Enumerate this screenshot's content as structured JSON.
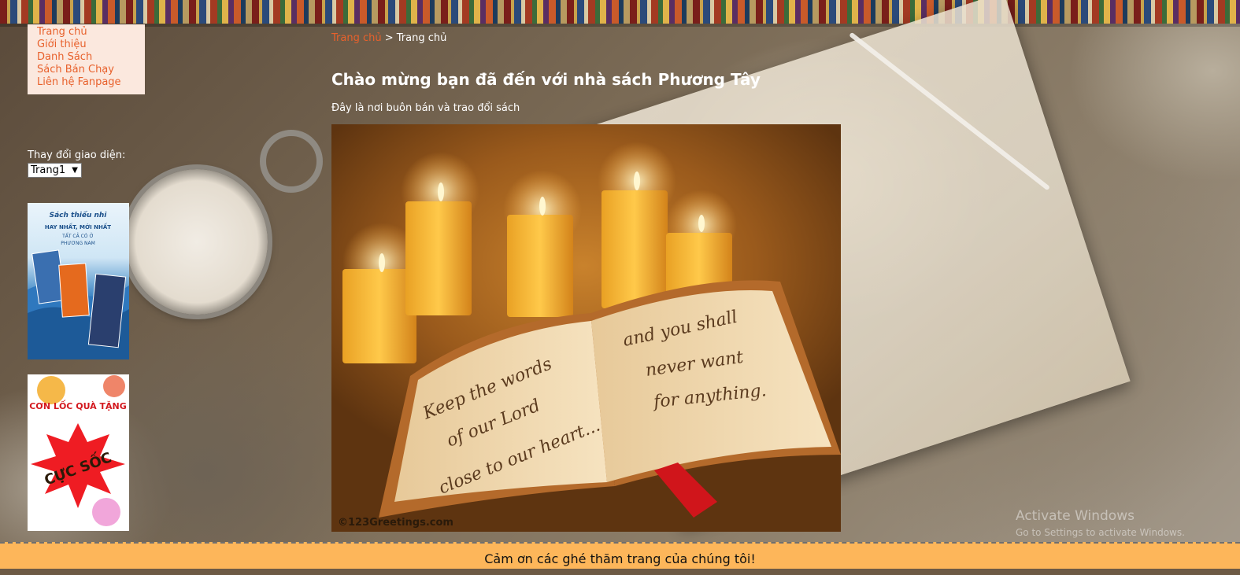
{
  "menu": {
    "items": [
      {
        "label": "Trang chủ"
      },
      {
        "label": "Giới thiệu"
      },
      {
        "label": "Danh Sách"
      },
      {
        "label": "Sách Bán Chạy"
      },
      {
        "label": "Liên hệ Fanpage"
      }
    ]
  },
  "theme": {
    "label": "Thay đổi giao diện:",
    "selected": "Trang1"
  },
  "ads": {
    "ad1": {
      "line1": "Sách thiếu nhi",
      "line2": "HAY NHẤT, MỚI NHẤT",
      "line3": "TẤT CẢ CÓ Ở",
      "line4": "PHƯƠNG NAM"
    },
    "ad2": {
      "line1": "CƠN LỐC QUÀ TẶNG",
      "line2": "CỰC SỐC"
    }
  },
  "breadcrumb": {
    "home": "Trang chủ",
    "separator": ">",
    "current": "Trang chủ"
  },
  "main": {
    "title": "Chào mừng bạn đã đến với nhà sách Phương Tây",
    "subtitle": "Đây là nơi buôn bán và trao đổi sách"
  },
  "hero": {
    "left_page": [
      "Keep the words",
      "of our Lord",
      "close to our heart..."
    ],
    "right_page": [
      "and you shall",
      "never want",
      "for anything."
    ],
    "credit": "©123Greetings.com"
  },
  "footer": {
    "text": "Cảm ơn các ghé thăm trang của chúng tôi!"
  },
  "system": {
    "activate_title": "Activate Windows",
    "activate_sub": "Go to Settings to activate Windows."
  },
  "colors": {
    "menu_link": "#e8612c",
    "footer_bg": "#fdb65a"
  }
}
